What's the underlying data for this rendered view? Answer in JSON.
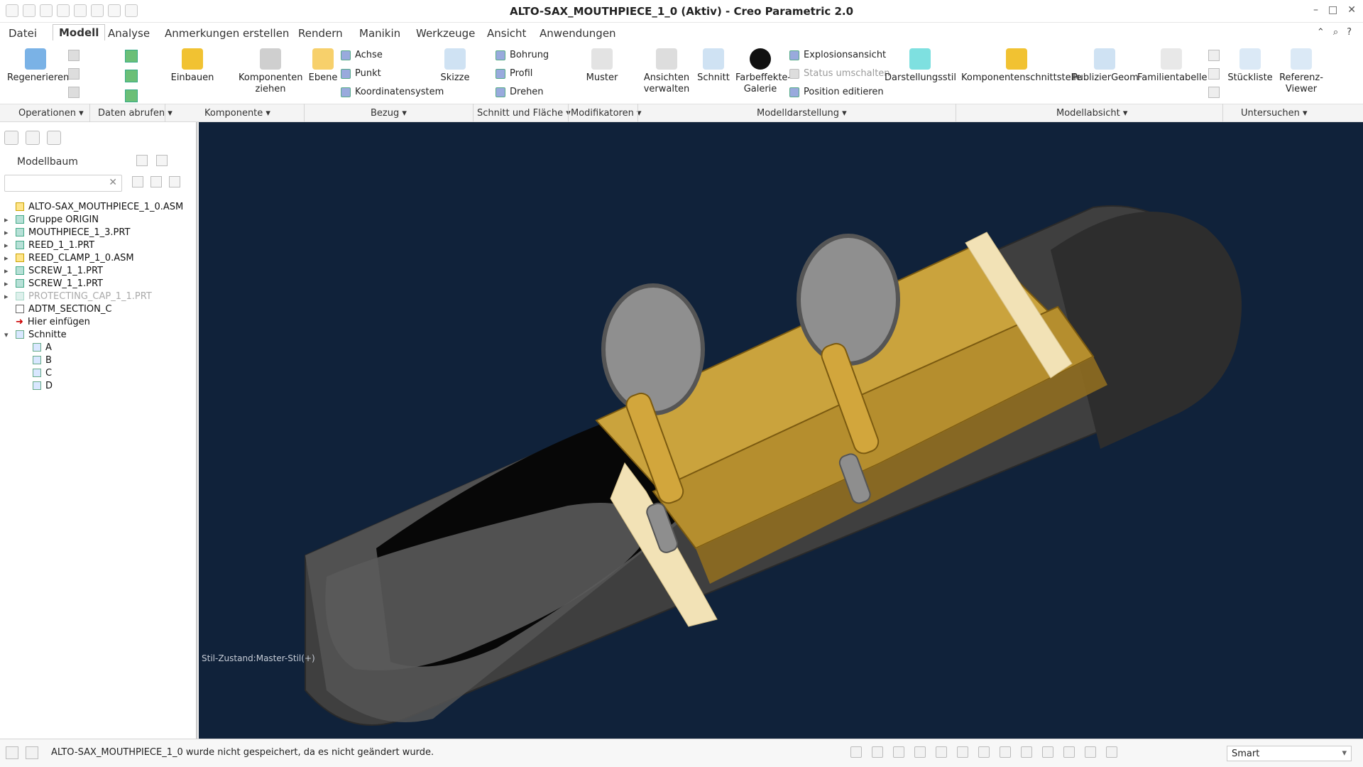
{
  "window": {
    "title": "ALTO-SAX_MOUTHPIECE_1_0 (Aktiv) - Creo Parametric 2.0"
  },
  "tabs": [
    {
      "label": "Datei"
    },
    {
      "label": "Modell"
    },
    {
      "label": "Analyse"
    },
    {
      "label": "Anmerkungen erstellen"
    },
    {
      "label": "Rendern"
    },
    {
      "label": "Manikin"
    },
    {
      "label": "Werkzeuge"
    },
    {
      "label": "Ansicht"
    },
    {
      "label": "Anwendungen"
    }
  ],
  "ribbon": {
    "regenerieren": "Regenerieren",
    "einbauen": "Einbauen",
    "komponenten_ziehen": "Komponenten ziehen",
    "ebene": "Ebene",
    "achse": "Achse",
    "punkt": "Punkt",
    "koordinatensystem": "Koordinatensystem",
    "skizze": "Skizze",
    "bohrung": "Bohrung",
    "profil": "Profil",
    "drehen": "Drehen",
    "muster": "Muster",
    "ansichten_verwalten": "Ansichten verwalten",
    "schnitt": "Schnitt",
    "farbeffekte_galerie": "Farbeffekte-Galerie",
    "explosionsansicht": "Explosionsansicht",
    "status_umschalten": "Status umschalten",
    "position_editieren": "Position editieren",
    "darstellungsstil": "Darstellungsstil",
    "komponentenschnittstelle": "Komponentenschnittstelle",
    "publiziergeom": "PublizierGeom",
    "familientabelle": "Familientabelle",
    "stueckliste": "Stückliste",
    "referenz_viewer": "Referenz-Viewer"
  },
  "group_labels": [
    {
      "label": "Operationen ▾"
    },
    {
      "label": "Daten abrufen ▾"
    },
    {
      "label": "Komponente ▾"
    },
    {
      "label": "Bezug ▾"
    },
    {
      "label": "Schnitt und Fläche ▾"
    },
    {
      "label": "Modifikatoren ▾"
    },
    {
      "label": "Modelldarstellung ▾"
    },
    {
      "label": "Modellabsicht ▾"
    },
    {
      "label": "Untersuchen ▾"
    }
  ],
  "model_tree": {
    "title": "Modellbaum",
    "search_placeholder": "",
    "items": [
      {
        "label": "ALTO-SAX_MOUTHPIECE_1_0.ASM"
      },
      {
        "label": "Gruppe ORIGIN"
      },
      {
        "label": "MOUTHPIECE_1_3.PRT"
      },
      {
        "label": "REED_1_1.PRT"
      },
      {
        "label": "REED_CLAMP_1_0.ASM"
      },
      {
        "label": "SCREW_1_1.PRT"
      },
      {
        "label": "SCREW_1_1.PRT"
      },
      {
        "label": "PROTECTING_CAP_1_1.PRT"
      },
      {
        "label": "ADTM_SECTION_C"
      },
      {
        "label": "Hier einfügen"
      },
      {
        "label": "Schnitte"
      },
      {
        "label": "A"
      },
      {
        "label": "B"
      },
      {
        "label": "C"
      },
      {
        "label": "D"
      }
    ]
  },
  "viewport": {
    "style_state": "Stil-Zustand:Master-Stil(+)"
  },
  "status": {
    "message": "ALTO-SAX_MOUTHPIECE_1_0 wurde nicht gespeichert, da es nicht geändert wurde.",
    "selection_filter": "Smart"
  },
  "colors": {
    "viewport_bg": "#10223a",
    "brass": "#c9a23a",
    "mouthpiece": "#4a4a4a"
  }
}
